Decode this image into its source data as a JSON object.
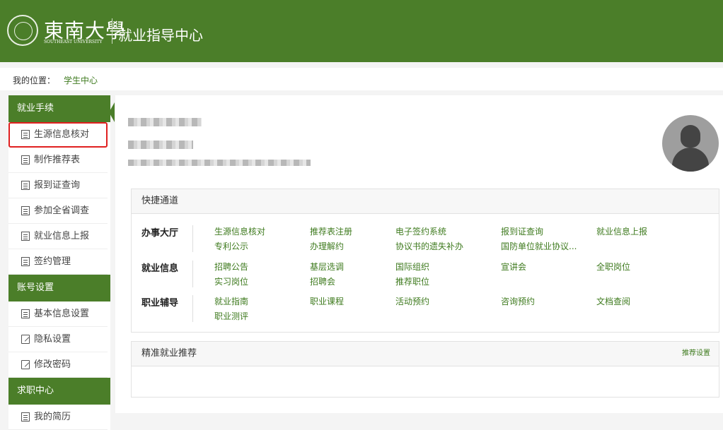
{
  "header": {
    "logo_cn": "東南大學",
    "logo_en": "SOUTHEAST UNIVERSITY",
    "title": "就业指导中心"
  },
  "breadcrumb": {
    "label": "我的位置：",
    "current": "学生中心"
  },
  "sidebar": {
    "sections": [
      {
        "title": "就业手续",
        "items": [
          "生源信息核对",
          "制作推荐表",
          "报到证查询",
          "参加全省调查",
          "就业信息上报",
          "签约管理"
        ]
      },
      {
        "title": "账号设置",
        "items": [
          "基本信息设置",
          "隐私设置",
          "修改密码"
        ]
      },
      {
        "title": "求职中心",
        "items": [
          "我的简历"
        ]
      }
    ],
    "active_item": "生源信息核对"
  },
  "quick_access": {
    "title": "快捷通道",
    "rows": [
      {
        "title": "办事大厅",
        "links": [
          "生源信息核对",
          "推荐表注册",
          "电子签约系统",
          "报到证查询",
          "就业信息上报",
          "专利公示",
          "办理解约",
          "协议书的遗失补办",
          "国防单位就业协议..."
        ]
      },
      {
        "title": "就业信息",
        "links": [
          "招聘公告",
          "基层选调",
          "国际组织",
          "宣讲会",
          "全职岗位",
          "实习岗位",
          "招聘会",
          "推荐职位"
        ]
      },
      {
        "title": "职业辅导",
        "links": [
          "就业指南",
          "职业课程",
          "活动预约",
          "咨询预约",
          "文档查阅",
          "职业测评"
        ]
      }
    ]
  },
  "recommend": {
    "title": "精准就业推荐",
    "settings_link": "推荐设置"
  },
  "colors": {
    "brand_green": "#4b7e29",
    "link_green": "#3f7b1f",
    "highlight_red": "#e02020"
  }
}
